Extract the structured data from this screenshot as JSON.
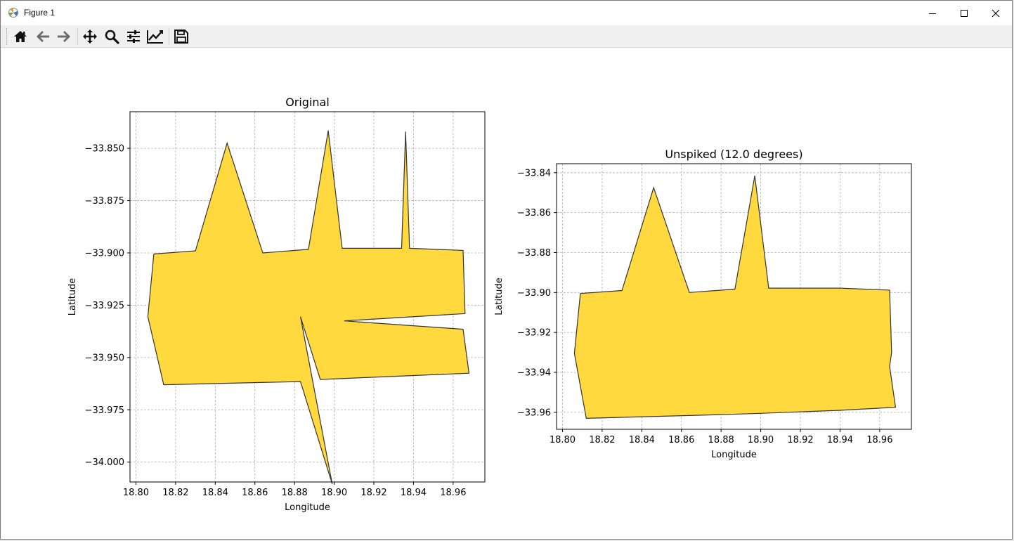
{
  "window": {
    "title": "Figure 1",
    "controls": {
      "minimize": "minimize-icon",
      "maximize": "maximize-icon",
      "close": "close-icon"
    }
  },
  "toolbar": {
    "buttons": [
      {
        "name": "home",
        "icon": "home-icon"
      },
      {
        "name": "back",
        "icon": "back-arrow-icon"
      },
      {
        "name": "forward",
        "icon": "forward-arrow-icon"
      },
      {
        "name": "pan",
        "icon": "move-icon"
      },
      {
        "name": "zoom",
        "icon": "zoom-icon"
      },
      {
        "name": "configure-subplots",
        "icon": "sliders-icon"
      },
      {
        "name": "edit-axis",
        "icon": "line-chart-icon"
      },
      {
        "name": "save",
        "icon": "save-icon"
      }
    ]
  },
  "colors": {
    "fill": "#ffd93d",
    "edge": "#333333",
    "grid": "#b0b0b0"
  },
  "chart_data": [
    {
      "type": "area",
      "title": "Original",
      "xlabel": "Longitude",
      "ylabel": "Latitude",
      "xlim": [
        18.797,
        18.976
      ],
      "ylim": [
        -34.0095,
        -33.8325
      ],
      "xticks": [
        18.8,
        18.82,
        18.84,
        18.86,
        18.88,
        18.9,
        18.92,
        18.94,
        18.96
      ],
      "xtick_labels": [
        "18.80",
        "18.82",
        "18.84",
        "18.86",
        "18.88",
        "18.90",
        "18.92",
        "18.94",
        "18.96"
      ],
      "yticks": [
        -33.85,
        -33.875,
        -33.9,
        -33.925,
        -33.95,
        -33.975,
        -34.0
      ],
      "ytick_labels": [
        "−33.850",
        "−33.875",
        "−33.900",
        "−33.925",
        "−33.950",
        "−33.975",
        "−34.000"
      ],
      "grid": true,
      "polygon": [
        [
          18.809,
          -33.9005
        ],
        [
          18.83,
          -33.899
        ],
        [
          18.846,
          -33.8475
        ],
        [
          18.864,
          -33.9
        ],
        [
          18.887,
          -33.8983
        ],
        [
          18.897,
          -33.8415
        ],
        [
          18.904,
          -33.8978
        ],
        [
          18.934,
          -33.8978
        ],
        [
          18.936,
          -33.842
        ],
        [
          18.938,
          -33.8978
        ],
        [
          18.965,
          -33.8988
        ],
        [
          18.966,
          -33.929
        ],
        [
          18.905,
          -33.9325
        ],
        [
          18.965,
          -33.9365
        ],
        [
          18.968,
          -33.9575
        ],
        [
          18.893,
          -33.9605
        ],
        [
          18.883,
          -33.9305
        ],
        [
          18.899,
          -34.0105
        ],
        [
          18.883,
          -33.9615
        ],
        [
          18.814,
          -33.963
        ],
        [
          18.806,
          -33.9305
        ]
      ]
    },
    {
      "type": "area",
      "title": "Unspiked (12.0 degrees)",
      "xlabel": "Longitude",
      "ylabel": "Latitude",
      "xlim": [
        18.797,
        18.976
      ],
      "ylim": [
        -33.9685,
        -33.8355
      ],
      "xticks": [
        18.8,
        18.82,
        18.84,
        18.86,
        18.88,
        18.9,
        18.92,
        18.94,
        18.96
      ],
      "xtick_labels": [
        "18.80",
        "18.82",
        "18.84",
        "18.86",
        "18.88",
        "18.90",
        "18.92",
        "18.94",
        "18.96"
      ],
      "yticks": [
        -33.84,
        -33.86,
        -33.88,
        -33.9,
        -33.92,
        -33.94,
        -33.96
      ],
      "ytick_labels": [
        "−33.84",
        "−33.86",
        "−33.88",
        "−33.90",
        "−33.92",
        "−33.94",
        "−33.96"
      ],
      "grid": true,
      "polygon": [
        [
          18.809,
          -33.9005
        ],
        [
          18.83,
          -33.899
        ],
        [
          18.846,
          -33.8475
        ],
        [
          18.864,
          -33.9
        ],
        [
          18.887,
          -33.8983
        ],
        [
          18.897,
          -33.8415
        ],
        [
          18.904,
          -33.8978
        ],
        [
          18.94,
          -33.8978
        ],
        [
          18.965,
          -33.8988
        ],
        [
          18.966,
          -33.93
        ],
        [
          18.965,
          -33.937
        ],
        [
          18.968,
          -33.9575
        ],
        [
          18.94,
          -33.959
        ],
        [
          18.9,
          -33.9605
        ],
        [
          18.885,
          -33.961
        ],
        [
          18.812,
          -33.963
        ],
        [
          18.806,
          -33.9305
        ]
      ]
    }
  ]
}
